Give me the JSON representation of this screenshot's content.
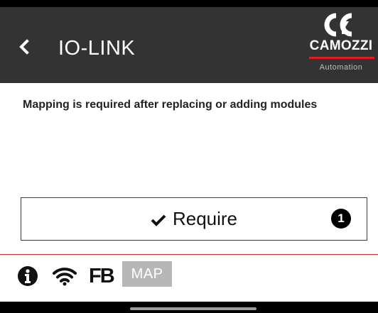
{
  "header": {
    "back_glyph": "‹",
    "title": "IO-LINK",
    "logo": {
      "brand": "CAMOZZI",
      "subtitle": "Automation"
    }
  },
  "main": {
    "message": "Mapping is required after replacing or adding modules",
    "require_button": {
      "label": "Require",
      "badge": "1"
    }
  },
  "footer": {
    "icons": [
      "info-icon",
      "wifi-icon"
    ],
    "fb_label": "FB",
    "map_label": "MAP"
  },
  "colors": {
    "header_bg": "#333333",
    "accent_red": "#e21b23",
    "map_tab_bg": "#b7b7b7"
  }
}
